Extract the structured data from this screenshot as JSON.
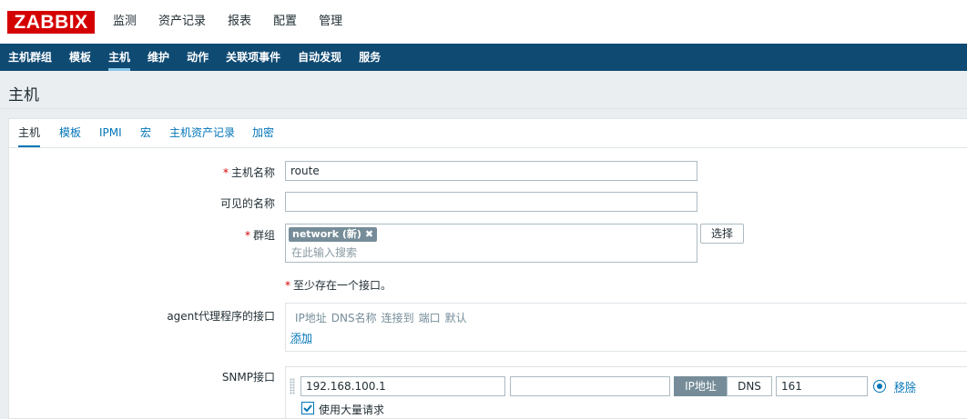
{
  "logo": "ZABBIX",
  "main_menu": [
    "监测",
    "资产记录",
    "报表",
    "配置",
    "管理"
  ],
  "sub_menu": [
    "主机群组",
    "模板",
    "主机",
    "维护",
    "动作",
    "关联项事件",
    "自动发现",
    "服务"
  ],
  "page_title": "主机",
  "tabs": [
    "主机",
    "模板",
    "IPMI",
    "宏",
    "主机资产记录",
    "加密"
  ],
  "form": {
    "required_mark": "*",
    "hostname_label": "主机名称",
    "hostname_value": "route",
    "visible_name_label": "可见的名称",
    "visible_name_value": "",
    "groups_label": "群组",
    "group_chip": "network (新)",
    "group_chip_remove": "✖",
    "groups_placeholder": "在此输入搜索",
    "select_button": "选择",
    "interface_hint": "至少存在一个接口。",
    "agent_label": "agent代理程序的接口",
    "interface_headers": [
      "IP地址",
      "DNS名称",
      "连接到",
      "端口",
      "默认"
    ],
    "add_link": "添加",
    "snmp_label": "SNMP接口",
    "snmp_ip": "192.168.100.1",
    "snmp_dns": "",
    "connect_ip": "IP地址",
    "connect_dns": "DNS",
    "snmp_port": "161",
    "remove_link": "移除",
    "bulk_label": "使用大量请求"
  },
  "colors": {
    "brand": "#d40000",
    "nav": "#0f4a73",
    "link": "#0275b8"
  }
}
